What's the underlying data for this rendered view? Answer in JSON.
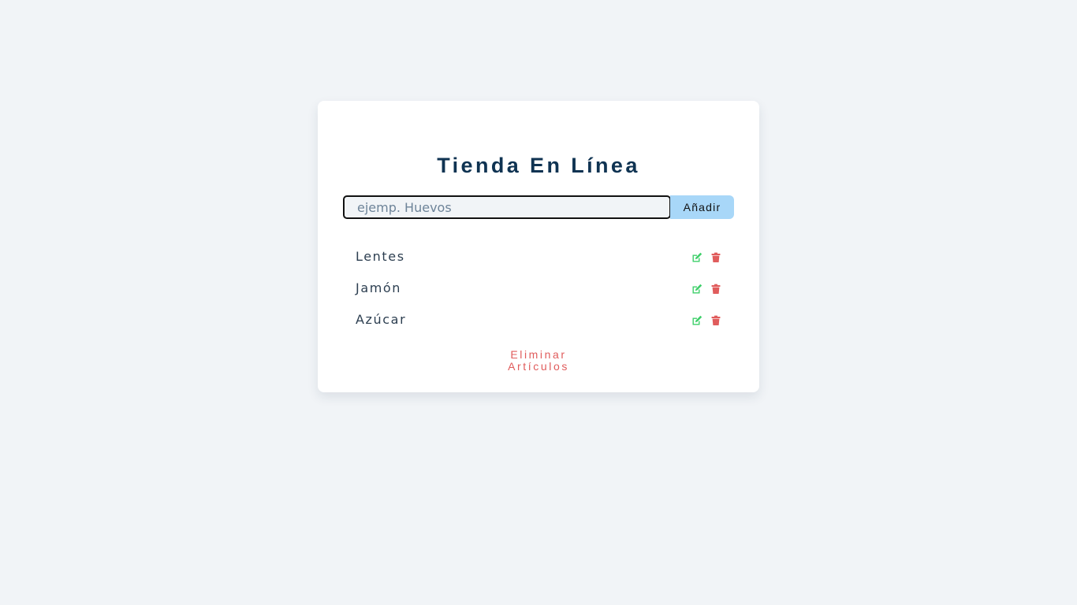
{
  "app": {
    "title": "Tienda En Línea"
  },
  "form": {
    "input_value": "",
    "input_placeholder": "ejemp. Huevos",
    "add_label": "Añadir"
  },
  "items": [
    {
      "name": "Lentes"
    },
    {
      "name": "Jamón"
    },
    {
      "name": "Azúcar"
    }
  ],
  "actions": {
    "edit_icon": "edit-icon",
    "delete_icon": "trash-icon",
    "clear_label": "Eliminar Artículos"
  },
  "colors": {
    "background": "#f1f4f7",
    "card": "#ffffff",
    "title": "#0f3352",
    "add_button": "#a8d7f8",
    "edit": "#3ecf6a",
    "delete": "#e05c5c",
    "clear_text": "#e05c5c"
  }
}
